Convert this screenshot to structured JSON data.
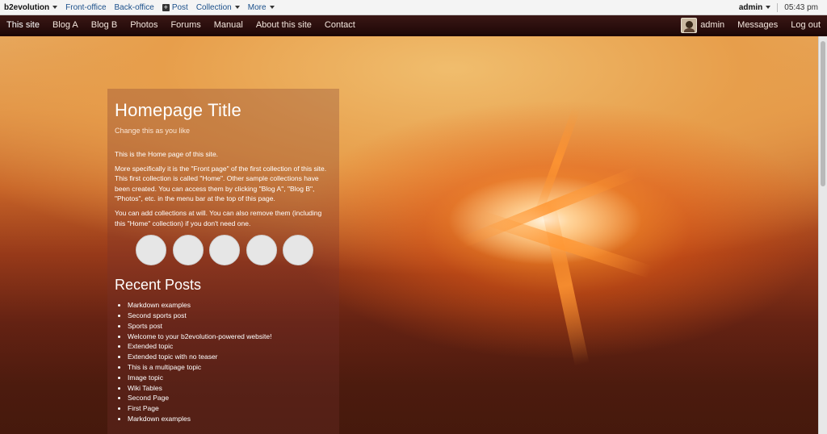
{
  "toolbar": {
    "brand": "b2evolution",
    "items": [
      "Front-office",
      "Back-office",
      "Post",
      "Collection",
      "More"
    ],
    "user": "admin",
    "time": "05:43 pm"
  },
  "sitemenu": {
    "items": [
      "This site",
      "Blog A",
      "Blog B",
      "Photos",
      "Forums",
      "Manual",
      "About this site",
      "Contact"
    ],
    "user": "admin",
    "messages": "Messages",
    "logout": "Log out"
  },
  "main": {
    "title": "Homepage Title",
    "subtitle": "Change this as you like",
    "paragraphs": [
      "This is the Home page of this site.",
      "More specifically it is the \"Front page\" of the first collection of this site. This first collection is called \"Home\". Other sample collections have been created. You can access them by clicking \"Blog A\", \"Blog B\", \"Photos\", etc. in the menu bar at the top of this page.",
      "You can add collections at will. You can also remove them (including this \"Home\" collection) if you don't need one."
    ],
    "social_buttons": 5,
    "recent_title": "Recent Posts",
    "recent_posts": [
      "Markdown examples",
      "Second sports post",
      "Sports post",
      "Welcome to your b2evolution-powered website!",
      "Extended topic",
      "Extended topic with no teaser",
      "This is a multipage topic",
      "Image topic",
      "Wiki Tables",
      "Second Page",
      "First Page",
      "Markdown examples"
    ]
  },
  "colors": {
    "toolbar_bg": "#f4f4f4",
    "menubar_bg": "#2a0e0c",
    "accent": "#e7a253"
  }
}
